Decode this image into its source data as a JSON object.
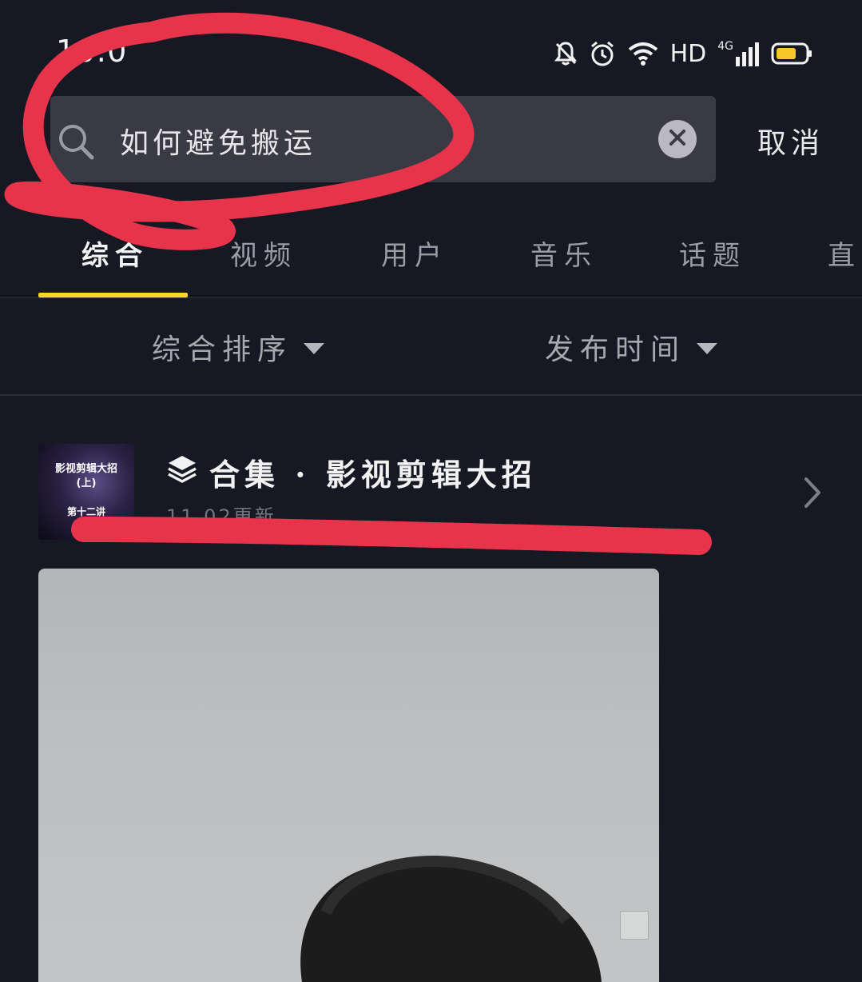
{
  "status_bar": {
    "time": "10:0",
    "hd_label": "HD",
    "network_label": "4G",
    "icons": [
      "bell-muted-icon",
      "alarm-icon",
      "wifi-icon",
      "signal-icon",
      "battery-icon"
    ],
    "battery_color": "#f6c726"
  },
  "search": {
    "query": "如何避免搬运",
    "cancel_label": "取消"
  },
  "tabs": [
    {
      "label": "综合",
      "active": true
    },
    {
      "label": "视频",
      "active": false
    },
    {
      "label": "用户",
      "active": false
    },
    {
      "label": "音乐",
      "active": false
    },
    {
      "label": "话题",
      "active": false
    },
    {
      "label": "直",
      "active": false
    }
  ],
  "filters": {
    "sort_label": "综合排序",
    "time_label": "发布时间"
  },
  "collection": {
    "thumb_line1": "影视剪辑大招",
    "thumb_line2": "(上)",
    "thumb_line3": "第十二讲",
    "title": "合集 · 影视剪辑大招",
    "updated": "11.02更新"
  },
  "colors": {
    "background": "#161823",
    "accent_underline": "#fbd72b",
    "annotation_red": "#e8344a"
  }
}
